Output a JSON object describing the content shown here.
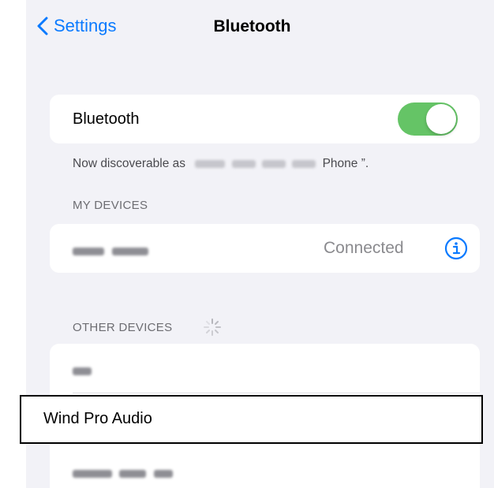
{
  "navbar": {
    "back_label": "Settings",
    "title": "Bluetooth"
  },
  "bluetooth_toggle": {
    "label": "Bluetooth",
    "state": "on",
    "color": "#65c466"
  },
  "discoverable": {
    "prefix": "Now discoverable as",
    "suffix": "Phone ”."
  },
  "my_devices": {
    "header": "MY DEVICES",
    "devices": [
      {
        "status": "Connected",
        "info_icon": "info-circle-icon"
      }
    ]
  },
  "other_devices": {
    "header": "OTHER DEVICES",
    "spinner_icon": "activity-spinner-icon",
    "devices": [
      {
        "label": ""
      },
      {
        "label": "Wind Pro Audio",
        "selected": true
      },
      {
        "label": ""
      }
    ]
  },
  "colors": {
    "accent": "#0a7aff",
    "background": "#f2f2f7"
  }
}
